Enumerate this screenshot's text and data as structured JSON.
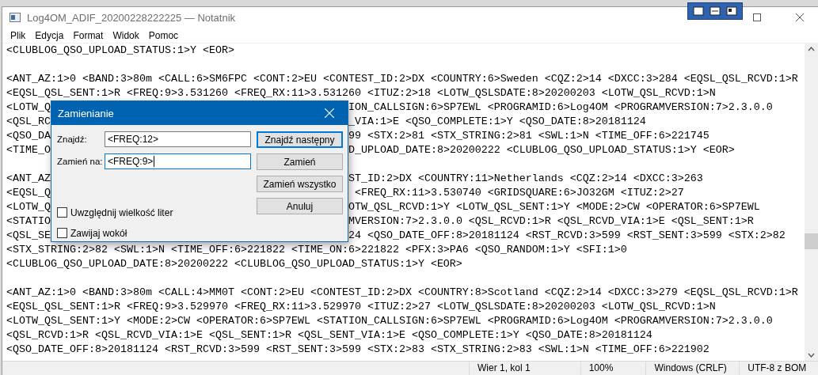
{
  "window": {
    "title": "Log4OM_ADIF_20200228222225 — Notatnik"
  },
  "menu": [
    {
      "label": "Plik"
    },
    {
      "label": "Edycja"
    },
    {
      "label": "Format"
    },
    {
      "label": "Widok"
    },
    {
      "label": "Pomoc"
    }
  ],
  "editor": {
    "lines": [
      {
        "kind": "text",
        "text": "<CLUBLOG_QSO_UPLOAD_STATUS:1>Y <EOR>"
      },
      {
        "kind": "blank"
      },
      {
        "kind": "text",
        "text": "<ANT_AZ:1>0 <BAND:3>80m <CALL:6>SM6FPC <CONT:2>EU <CONTEST_ID:2>DX <COUNTRY:6>Sweden <CQZ:2>14 <DXCC:3>284 <EQSL_QSL_RCVD:1>R"
      },
      {
        "kind": "text",
        "text": "<EQSL_QSL_SENT:1>R <FREQ:9>3.531260 <FREQ_RX:11>3.531260 <ITUZ:2>18 <LOTW_QSLSDATE:8>20200203 <LOTW_QSL_RCVD:1>N"
      },
      {
        "kind": "split",
        "left": "<LOTW_Q",
        "right": "ION_CALLSIGN:6>SP7EWL <PROGRAMID:6>Log4OM <PROGRAMVERSION:7>2.3.0.0"
      },
      {
        "kind": "split",
        "left": "<QSL_RC",
        "right": "_VIA:1>E <QSO_COMPLETE:1>Y <QSO_DATE:8>20181124"
      },
      {
        "kind": "split",
        "left": "<QSO_DA",
        "right": "99 <STX:2>81 <STX_STRING:2>81 <SWL:1>N <TIME_OFF:6>221745"
      },
      {
        "kind": "split",
        "left": "<TIME_O",
        "right": "D_UPLOAD_DATE:8>20200222 <CLUBLOG_QSO_UPLOAD_STATUS:1>Y <EOR>"
      },
      {
        "kind": "blank"
      },
      {
        "kind": "split",
        "left": "<ANT_AZ",
        "right": "ST_ID:2>DX <COUNTRY:11>Netherlands <CQZ:2>14 <DXCC:3>263"
      },
      {
        "kind": "split",
        "left": "<EQSL_Q",
        "right": " <FREQ_RX:11>3.530740 <GRIDSQUARE:6>JO32GM <ITUZ:2>27"
      },
      {
        "kind": "split",
        "left": "<LOTW_Q",
        "right": "OTW_QSL_RCVD:1>Y <LOTW_QSL_SENT:1>Y <MODE:2>CW <OPERATOR:6>SP7EWL"
      },
      {
        "kind": "split",
        "left": "<STATIO",
        "right": "MVERSION:7>2.3.0.0 <QSL_RCVD:1>R <QSL_RCVD_VIA:1>E <QSL_SENT:1>R"
      },
      {
        "kind": "split",
        "left": "<QSL_SE",
        "right": "24 <QSO_DATE_OFF:8>20181124 <RST_RCVD:3>599 <RST_SENT:3>599 <STX:2>82"
      },
      {
        "kind": "text",
        "text": "<STX_STRING:2>82 <SWL:1>N <TIME_OFF:6>221822 <TIME_ON:6>221822 <PFX:3>PA6 <QSO_RANDOM:1>Y <SFI:1>0"
      },
      {
        "kind": "text",
        "text": "<CLUBLOG_QSO_UPLOAD_DATE:8>20200222 <CLUBLOG_QSO_UPLOAD_STATUS:1>Y <EOR>"
      },
      {
        "kind": "blank"
      },
      {
        "kind": "text",
        "text": "<ANT_AZ:1>0 <BAND:3>80m <CALL:4>MM0T <CONT:2>EU <CONTEST_ID:2>DX <COUNTRY:8>Scotland <CQZ:2>14 <DXCC:3>279 <EQSL_QSL_RCVD:1>R"
      },
      {
        "kind": "text",
        "text": "<EQSL_QSL_SENT:1>R <FREQ:9>3.529970 <FREQ_RX:11>3.529970 <ITUZ:2>27 <LOTW_QSLSDATE:8>20200203 <LOTW_QSL_RCVD:1>N"
      },
      {
        "kind": "text",
        "text": "<LOTW_QSL_SENT:1>Y <MODE:2>CW <OPERATOR:6>SP7EWL <STATION_CALLSIGN:6>SP7EWL <PROGRAMID:6>Log4OM <PROGRAMVERSION:7>2.3.0.0"
      },
      {
        "kind": "text",
        "text": "<QSL_RCVD:1>R <QSL_RCVD_VIA:1>E <QSL_SENT:1>R <QSL_SENT_VIA:1>E <QSO_COMPLETE:1>Y <QSO_DATE:8>20181124"
      },
      {
        "kind": "text",
        "text": "<QSO_DATE_OFF:8>20181124 <RST_RCVD:3>599 <RST_SENT:3>599 <STX:2>83 <STX_STRING:2>83 <SWL:1>N <TIME_OFF:6>221902"
      }
    ]
  },
  "dialog": {
    "title": "Zamienianie",
    "fields": [
      {
        "label": "Znajdź:",
        "value": "<FREQ:12>",
        "focused": false
      },
      {
        "label": "Zamień na:",
        "value": "<FREQ:9>",
        "focused": true
      }
    ],
    "buttons": [
      {
        "label": "Znajdź następny",
        "default": true
      },
      {
        "label": "Zamień",
        "default": false
      },
      {
        "label": "Zamień wszystko",
        "default": false
      },
      {
        "label": "Anuluj",
        "default": false
      }
    ],
    "checkboxes": [
      {
        "label": "Uwzględnij wielkość liter",
        "checked": false
      },
      {
        "label": "Zawijaj wokół",
        "checked": false
      }
    ]
  },
  "status_bar": [
    {
      "text": "Wier 1, kol 1"
    },
    {
      "text": "100%"
    },
    {
      "text": "Windows (CRLF)"
    },
    {
      "text": "UTF-8 z BOM"
    }
  ]
}
